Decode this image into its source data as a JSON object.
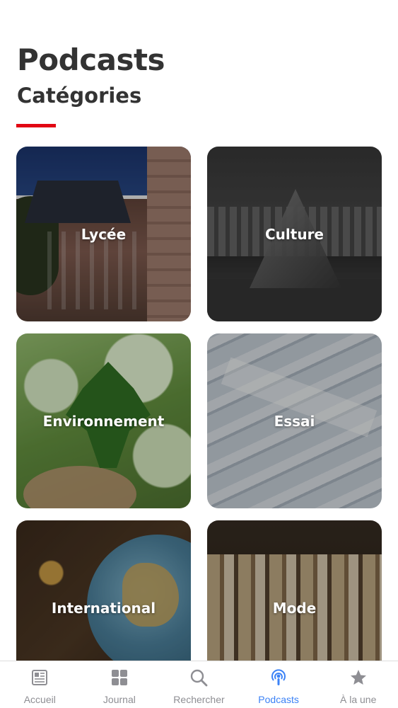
{
  "header": {
    "title": "Podcasts",
    "subtitle": "Catégories"
  },
  "categories": [
    {
      "label": "Lycée"
    },
    {
      "label": "Culture"
    },
    {
      "label": "Environnement"
    },
    {
      "label": "Essai"
    },
    {
      "label": "International"
    },
    {
      "label": "Mode"
    }
  ],
  "tabbar": {
    "items": [
      {
        "label": "Accueil",
        "icon": "newspaper-icon",
        "active": false
      },
      {
        "label": "Journal",
        "icon": "grid-icon",
        "active": false
      },
      {
        "label": "Rechercher",
        "icon": "search-icon",
        "active": false
      },
      {
        "label": "Podcasts",
        "icon": "podcast-icon",
        "active": true
      },
      {
        "label": "À la une",
        "icon": "star-icon",
        "active": false
      }
    ]
  },
  "colors": {
    "accent": "#e20613",
    "active_tab": "#3b82f6",
    "inactive_tab": "#8e8e93"
  }
}
